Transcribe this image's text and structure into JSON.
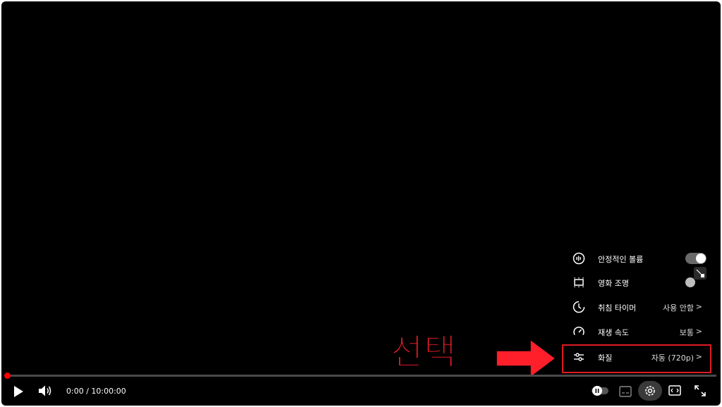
{
  "menu": {
    "items": [
      {
        "label": "안정적인 볼륨",
        "icon": "stable-volume-icon",
        "control": "toggle",
        "state": "on"
      },
      {
        "label": "영화 조명",
        "icon": "ambient-mode-icon",
        "control": "toggle",
        "state": "off"
      },
      {
        "label": "취침 타이머",
        "icon": "sleep-timer-icon",
        "value": "사용 안함",
        "chevron": ">"
      },
      {
        "label": "재생 속도",
        "icon": "playback-speed-icon",
        "value": "보통",
        "chevron": ">"
      },
      {
        "label": "화질",
        "icon": "quality-sliders-icon",
        "value": "자동 (720p)",
        "chevron": ">"
      }
    ]
  },
  "annotation": {
    "text": "선택",
    "color": "#ff1f2b"
  },
  "player": {
    "time": "0:00 / 10:00:00",
    "progress": 0.0
  },
  "colors": {
    "accent": "#ff0000",
    "highlight": "#e01b24"
  }
}
